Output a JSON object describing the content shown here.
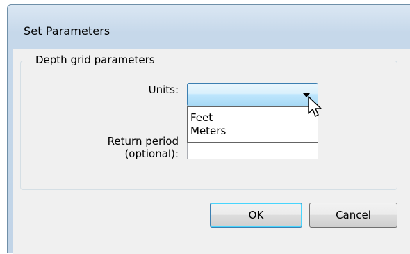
{
  "dialog": {
    "title": "Set Parameters"
  },
  "group": {
    "legend": "Depth grid parameters"
  },
  "units": {
    "label": "Units:",
    "selected_value": "",
    "options": [
      "Feet",
      "Meters"
    ]
  },
  "return_period": {
    "label_line1": "Return period",
    "label_line2": "(optional):",
    "value": ""
  },
  "buttons": {
    "ok": "OK",
    "cancel": "Cancel"
  },
  "icons": {
    "dropdown_arrow": "chevron-down-icon",
    "cursor": "mouse-pointer-icon"
  },
  "colors": {
    "title_bar": "#c6d8ea",
    "combo_highlight": "#a7d9f5",
    "client_bg": "#f0f0f0"
  }
}
